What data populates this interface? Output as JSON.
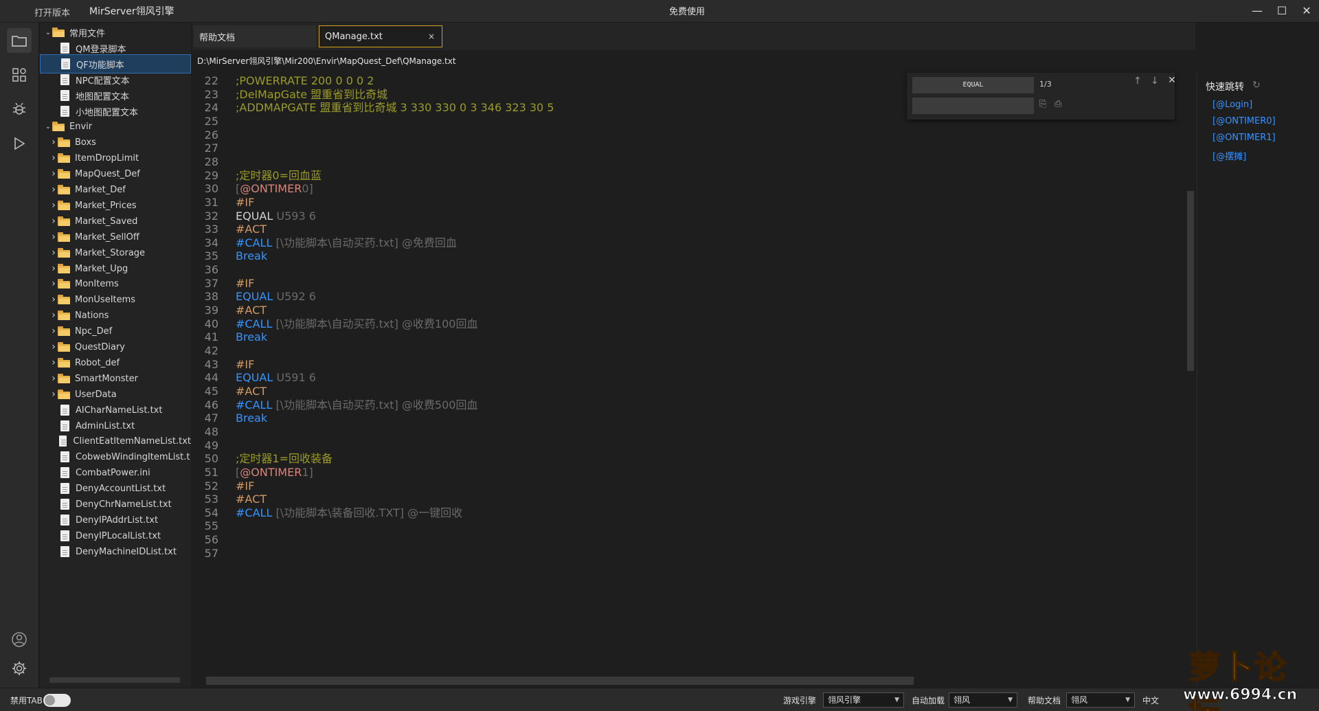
{
  "titlebar": {
    "open_version": "打开版本",
    "app_title": "MirServer翎风引擎",
    "center_title": "免费使用",
    "minimize": "—",
    "maximize": "☐",
    "close": "✕"
  },
  "activity_icons": [
    "folder-icon",
    "extensions-icon",
    "debug-icon",
    "run-icon",
    "account-icon",
    "gear-icon"
  ],
  "explorer": {
    "items": [
      {
        "label": "常用文件",
        "type": "folder",
        "expanded": true,
        "level": 0
      },
      {
        "label": "QM登录脚本",
        "type": "file",
        "level": 1
      },
      {
        "label": "QF功能脚本",
        "type": "file",
        "level": 1,
        "selected": true
      },
      {
        "label": "NPC配置文本",
        "type": "file",
        "level": 1
      },
      {
        "label": "地图配置文本",
        "type": "file",
        "level": 1
      },
      {
        "label": "小地图配置文本",
        "type": "file",
        "level": 1
      },
      {
        "label": "Envir",
        "type": "folder",
        "expanded": true,
        "level": 0
      },
      {
        "label": "Boxs",
        "type": "folder",
        "level": 1
      },
      {
        "label": "ItemDropLimit",
        "type": "folder",
        "level": 1
      },
      {
        "label": "MapQuest_Def",
        "type": "folder",
        "level": 1
      },
      {
        "label": "Market_Def",
        "type": "folder",
        "level": 1
      },
      {
        "label": "Market_Prices",
        "type": "folder",
        "level": 1
      },
      {
        "label": "Market_Saved",
        "type": "folder",
        "level": 1
      },
      {
        "label": "Market_SellOff",
        "type": "folder",
        "level": 1
      },
      {
        "label": "Market_Storage",
        "type": "folder",
        "level": 1
      },
      {
        "label": "Market_Upg",
        "type": "folder",
        "level": 1
      },
      {
        "label": "MonItems",
        "type": "folder",
        "level": 1
      },
      {
        "label": "MonUseItems",
        "type": "folder",
        "level": 1
      },
      {
        "label": "Nations",
        "type": "folder",
        "level": 1
      },
      {
        "label": "Npc_Def",
        "type": "folder",
        "level": 1
      },
      {
        "label": "QuestDiary",
        "type": "folder",
        "level": 1
      },
      {
        "label": "Robot_def",
        "type": "folder",
        "level": 1
      },
      {
        "label": "SmartMonster",
        "type": "folder",
        "level": 1
      },
      {
        "label": "UserData",
        "type": "folder",
        "level": 1
      },
      {
        "label": "AICharNameList.txt",
        "type": "file",
        "level": 1
      },
      {
        "label": "AdminList.txt",
        "type": "file",
        "level": 1
      },
      {
        "label": "ClientEatItemNameList.txt",
        "type": "file",
        "level": 1
      },
      {
        "label": "CobwebWindingItemList.t",
        "type": "file",
        "level": 1
      },
      {
        "label": "CombatPower.ini",
        "type": "file",
        "level": 1
      },
      {
        "label": "DenyAccountList.txt",
        "type": "file",
        "level": 1
      },
      {
        "label": "DenyChrNameList.txt",
        "type": "file",
        "level": 1
      },
      {
        "label": "DenyIPAddrList.txt",
        "type": "file",
        "level": 1
      },
      {
        "label": "DenyIPLocalList.txt",
        "type": "file",
        "level": 1
      },
      {
        "label": "DenyMachineIDList.txt",
        "type": "file",
        "level": 1
      }
    ]
  },
  "tabs": [
    {
      "label": "帮助文档",
      "active": false
    },
    {
      "label": "QManage.txt",
      "active": true,
      "close": "×"
    }
  ],
  "path": "D:\\MirServer翎风引擎\\Mir200\\Envir\\MapQuest_Def\\QManage.txt",
  "editor": {
    "lines": [
      {
        "n": "22",
        "parts": [
          {
            "t": ";POWERRATE 200 0 0 0 2",
            "c": "comment"
          }
        ]
      },
      {
        "n": "23",
        "parts": [
          {
            "t": ";DelMapGate 盟重省到比奇城",
            "c": "comment"
          }
        ]
      },
      {
        "n": "24",
        "parts": [
          {
            "t": ";ADDMAPGATE 盟重省到比奇城 3 330 330 0 3 346 323 30 5",
            "c": "comment"
          }
        ]
      },
      {
        "n": "25",
        "parts": []
      },
      {
        "n": "26",
        "parts": []
      },
      {
        "n": "27",
        "parts": []
      },
      {
        "n": "28",
        "parts": []
      },
      {
        "n": "29",
        "parts": [
          {
            "t": ";定时器0=回血蓝",
            "c": "comment"
          }
        ]
      },
      {
        "n": "30",
        "parts": [
          {
            "t": "[",
            "c": "gray"
          },
          {
            "t": "@ONTIMER",
            "c": "label"
          },
          {
            "t": "0]",
            "c": "gray"
          }
        ]
      },
      {
        "n": "31",
        "parts": [
          {
            "t": "#IF",
            "c": "keyword"
          }
        ]
      },
      {
        "n": "32",
        "parts": [
          {
            "t": "EQUAL",
            "c": "hl"
          },
          {
            "t": " U593 6",
            "c": "gray"
          }
        ]
      },
      {
        "n": "33",
        "parts": [
          {
            "t": "#ACT",
            "c": "keyword"
          }
        ]
      },
      {
        "n": "34",
        "parts": [
          {
            "t": "#CALL",
            "c": "blue"
          },
          {
            "t": " [\\功能脚本\\自动买药.txt] @免费回血",
            "c": "gray"
          }
        ]
      },
      {
        "n": "35",
        "parts": [
          {
            "t": "Break",
            "c": "blue"
          }
        ]
      },
      {
        "n": "36",
        "parts": []
      },
      {
        "n": "37",
        "parts": [
          {
            "t": "#IF",
            "c": "keyword"
          }
        ]
      },
      {
        "n": "38",
        "parts": [
          {
            "t": "EQUAL",
            "c": "blue"
          },
          {
            "t": " U592 6",
            "c": "gray"
          }
        ]
      },
      {
        "n": "39",
        "parts": [
          {
            "t": "#ACT",
            "c": "keyword"
          }
        ]
      },
      {
        "n": "40",
        "parts": [
          {
            "t": "#CALL",
            "c": "blue"
          },
          {
            "t": " [\\功能脚本\\自动买药.txt] @收费100回血",
            "c": "gray"
          }
        ]
      },
      {
        "n": "41",
        "parts": [
          {
            "t": "Break",
            "c": "blue"
          }
        ]
      },
      {
        "n": "42",
        "parts": []
      },
      {
        "n": "43",
        "parts": [
          {
            "t": "#IF",
            "c": "keyword"
          }
        ]
      },
      {
        "n": "44",
        "parts": [
          {
            "t": "EQUAL",
            "c": "blue"
          },
          {
            "t": " U591 6",
            "c": "gray"
          }
        ]
      },
      {
        "n": "45",
        "parts": [
          {
            "t": "#ACT",
            "c": "keyword"
          }
        ]
      },
      {
        "n": "46",
        "parts": [
          {
            "t": "#CALL",
            "c": "blue"
          },
          {
            "t": " [\\功能脚本\\自动买药.txt] @收费500回血",
            "c": "gray"
          }
        ]
      },
      {
        "n": "47",
        "parts": [
          {
            "t": "Break",
            "c": "blue"
          }
        ]
      },
      {
        "n": "48",
        "parts": []
      },
      {
        "n": "49",
        "parts": []
      },
      {
        "n": "50",
        "parts": [
          {
            "t": ";定时器1=回收装备",
            "c": "comment"
          }
        ]
      },
      {
        "n": "51",
        "parts": [
          {
            "t": "[",
            "c": "gray"
          },
          {
            "t": "@ONTIMER",
            "c": "label"
          },
          {
            "t": "1]",
            "c": "gray"
          }
        ]
      },
      {
        "n": "52",
        "parts": [
          {
            "t": "#IF",
            "c": "keyword"
          }
        ]
      },
      {
        "n": "53",
        "parts": [
          {
            "t": "#ACT",
            "c": "keyword"
          }
        ]
      },
      {
        "n": "54",
        "parts": [
          {
            "t": "#CALL",
            "c": "blue"
          },
          {
            "t": " [\\功能脚本\\装备回收.TXT] @一键回收",
            "c": "gray"
          }
        ]
      },
      {
        "n": "55",
        "parts": []
      },
      {
        "n": "56",
        "parts": []
      },
      {
        "n": "57",
        "parts": []
      }
    ]
  },
  "find": {
    "query": "EQUAL",
    "count": "1/3",
    "replace_value": ""
  },
  "quickjump": {
    "title": "快速跳转",
    "items": [
      "[@Login]",
      "[@ONTIMER0]",
      "[@ONTIMER1]",
      "[@摆摊]"
    ]
  },
  "statusbar": {
    "disable_tab": "禁用TAB",
    "game_engine_label": "游戏引擎",
    "game_engine_value": "翎风引擎",
    "autoload_label": "自动加载",
    "autoload_value": "翎风",
    "help_doc_label": "帮助文档",
    "help_doc_value": "翎风",
    "lang": "中文"
  },
  "watermark": {
    "text": "萝卜论坛",
    "url": "www.6994.cn"
  },
  "colors": {
    "accent": "#3794ff",
    "comment": "#9b9b28",
    "keyword": "#d19a66",
    "tab_active_border": "#d2a21d",
    "folder": "#e9b54a"
  }
}
